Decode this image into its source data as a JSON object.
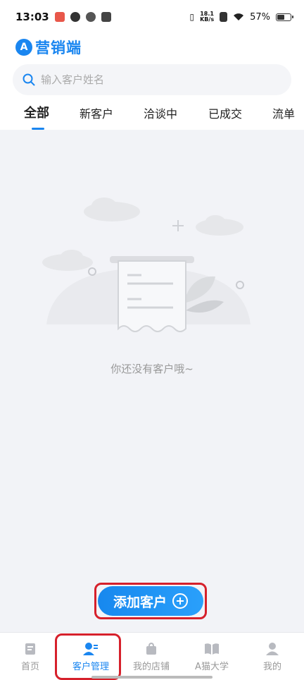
{
  "status_bar": {
    "time": "13:03",
    "net_speed_value": "18.1",
    "net_speed_unit": "KB/s",
    "battery_percent": "57%",
    "battery_level": 0.57
  },
  "header": {
    "brand_logo_letter": "A",
    "brand_name": "营销端",
    "search": {
      "placeholder": "输入客户姓名",
      "value": ""
    },
    "tabs": [
      {
        "label": "全部",
        "active": true
      },
      {
        "label": "新客户",
        "active": false
      },
      {
        "label": "洽谈中",
        "active": false
      },
      {
        "label": "已成交",
        "active": false
      },
      {
        "label": "流单",
        "active": false
      }
    ]
  },
  "empty_state": {
    "message": "你还没有客户哦~"
  },
  "actions": {
    "add_customer_label": "添加客户"
  },
  "bottom_nav": {
    "items": [
      {
        "label": "首页",
        "icon": "document-icon",
        "active": false
      },
      {
        "label": "客户管理",
        "icon": "customer-management-icon",
        "active": true
      },
      {
        "label": "我的店铺",
        "icon": "shop-bag-icon",
        "active": false
      },
      {
        "label": "A猫大学",
        "icon": "book-icon",
        "active": false
      },
      {
        "label": "我的",
        "icon": "profile-icon",
        "active": false
      }
    ]
  },
  "colors": {
    "accent": "#1a86f0",
    "highlight_border": "#d6202b",
    "inactive_text": "#999999",
    "page_background": "#f2f3f7"
  }
}
